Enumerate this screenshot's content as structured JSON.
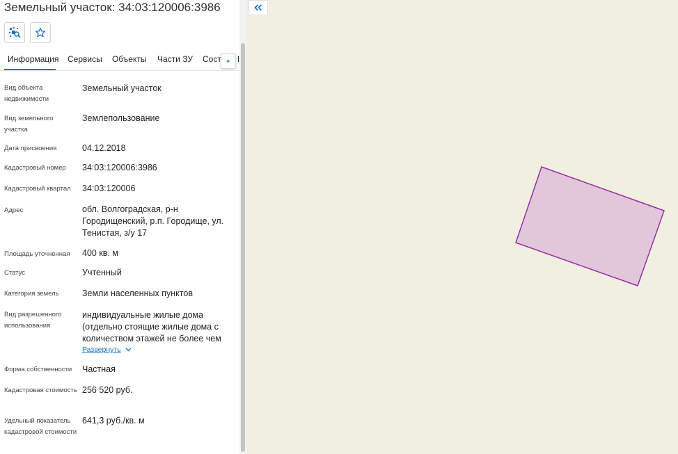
{
  "header": {
    "title": "Земельный участок: 34:03:120006:3986"
  },
  "toolbar": {
    "locate_icon": "locate-on-map-icon",
    "favorite_icon": "star-icon"
  },
  "tabs": [
    {
      "label": "Информация",
      "active": true
    },
    {
      "label": "Сервисы",
      "active": false
    },
    {
      "label": "Объекты",
      "active": false
    },
    {
      "label": "Части ЗУ",
      "active": false
    },
    {
      "label": "Соста",
      "active": false
    },
    {
      "label": "Г",
      "active": false
    }
  ],
  "info": [
    {
      "label": "Вид объекта недвижимости",
      "value": "Земельный участок"
    },
    {
      "label": "Вид земельного участка",
      "value": "Землепользование"
    },
    {
      "label": "Дата присвоения",
      "value": "04.12.2018"
    },
    {
      "label": "Кадастровый номер",
      "value": "34:03:120006:3986"
    },
    {
      "label": "Кадастровый квартал",
      "value": "34:03:120006"
    },
    {
      "label": "Адрес",
      "value": "обл. Волгоградская, р-н Городищенский, р.п. Городище, ул. Тенистая, з/у 17"
    },
    {
      "label": "Площадь уточненная",
      "value": "400 кв. м"
    },
    {
      "label": "Статус",
      "value": "Учтенный"
    },
    {
      "label": "Категория земель",
      "value": "Земли населенных пунктов"
    },
    {
      "label": "Вид разрешенного использования",
      "value": "индивидуальные жилые дома (отдельно стоящие жилые дома с количеством этажей не более чем"
    },
    {
      "label": "Форма собственности",
      "value": "Частная"
    },
    {
      "label": "Кадастровая стоимость",
      "value": "256 520 руб."
    },
    {
      "label": "Удельный показатель кадастровой стоимости",
      "value": "641,3 руб./кв. м"
    }
  ],
  "expand_label": "Развернуть",
  "colors": {
    "accent": "#1a73c4",
    "map_bg": "#f1efe0",
    "parcel_fill": "#e2c6da",
    "parcel_stroke": "#9b2ca6"
  }
}
